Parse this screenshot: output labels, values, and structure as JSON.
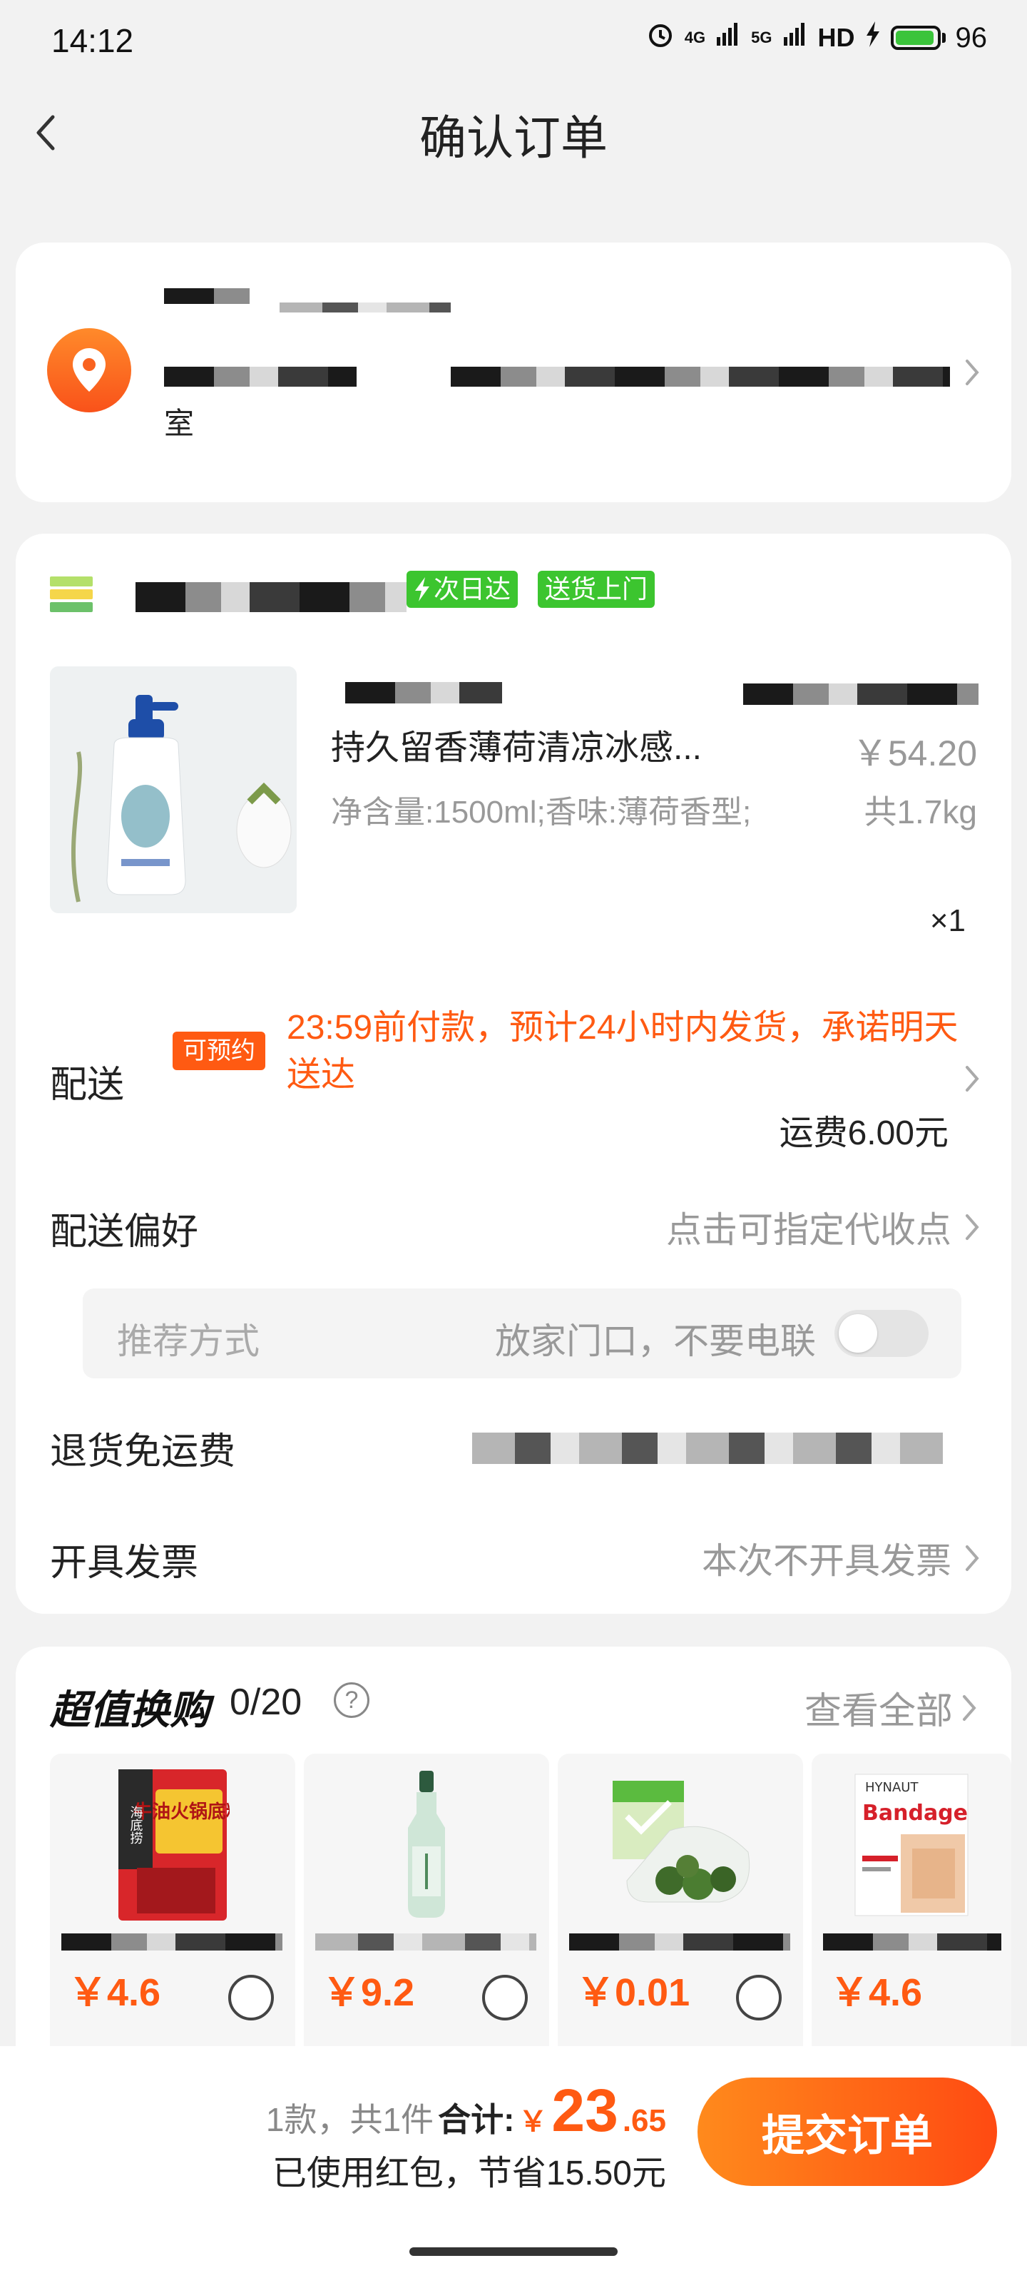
{
  "status_bar": {
    "time": "14:12",
    "signal_4g": "4G",
    "signal_5g": "5G",
    "hd": "HD",
    "battery": "96",
    "battery_level": 0.96
  },
  "header": {
    "title": "确认订单"
  },
  "address": {
    "suffix": "室"
  },
  "store": {
    "tags": [
      "次日达",
      "送货上门"
    ]
  },
  "product": {
    "name": "持久留香薄荷清凉冰感...",
    "price": "￥54.20",
    "spec": "净含量:1500ml;香味:薄荷香型;",
    "weight": "共1.7kg",
    "qty": "×1"
  },
  "delivery": {
    "label": "配送",
    "badge": "可预约",
    "note": "23:59前付款，预计24小时内发货，承诺明天送达",
    "fee": "运费6.00元"
  },
  "preference": {
    "label": "配送偏好",
    "value": "点击可指定代收点",
    "box_left": "推荐方式",
    "box_right": "放家门口，不要电联"
  },
  "return_shipping": {
    "label": "退货免运费"
  },
  "invoice": {
    "label": "开具发票",
    "value": "本次不开具发票"
  },
  "deals": {
    "title": "超值换购",
    "count": "0/20",
    "help": "?",
    "see_all": "查看全部",
    "items": [
      {
        "price": "￥4.6",
        "thumb_title": "牛油火锅底料",
        "brand": "海底捞"
      },
      {
        "price": "￥9.2"
      },
      {
        "price": "￥0.01"
      },
      {
        "price": "￥4.6",
        "thumb_title": "Bandage",
        "brand": "HYNAUT"
      }
    ]
  },
  "summary": {
    "meta": "1款，共1件",
    "total_label": "合计:",
    "yen": "￥",
    "total_int": "23",
    "total_dec": ".65",
    "saving": "已使用红包，节省15.50元",
    "submit": "提交订单"
  },
  "colors": {
    "accent": "#ff5a12",
    "green": "#3cc52f",
    "muted": "#999999"
  }
}
